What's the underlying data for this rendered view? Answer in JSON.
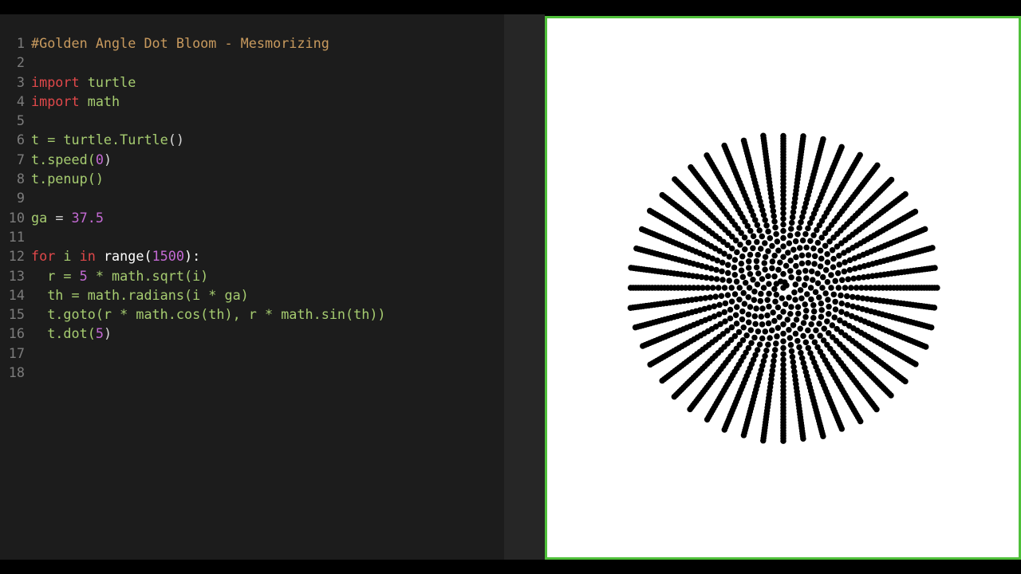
{
  "editor": {
    "lines": [
      {
        "num": "1",
        "tokens": [
          {
            "text": "#Golden Angle Dot Bloom - Mesmorizing",
            "kind": "comment"
          }
        ]
      },
      {
        "num": "2",
        "tokens": []
      },
      {
        "num": "3",
        "tokens": [
          {
            "text": "import",
            "kind": "keyword"
          },
          {
            "text": " turtle",
            "kind": "ident"
          }
        ]
      },
      {
        "num": "4",
        "tokens": [
          {
            "text": "import",
            "kind": "keyword"
          },
          {
            "text": " math",
            "kind": "ident"
          }
        ]
      },
      {
        "num": "5",
        "tokens": []
      },
      {
        "num": "6",
        "tokens": [
          {
            "text": "t = turtle.",
            "kind": "ident"
          },
          {
            "text": "Turtle",
            "kind": "ident"
          },
          {
            "text": "()",
            "kind": "default"
          }
        ]
      },
      {
        "num": "7",
        "tokens": [
          {
            "text": "t.speed(",
            "kind": "ident"
          },
          {
            "text": "0",
            "kind": "number"
          },
          {
            "text": ")",
            "kind": "default"
          }
        ]
      },
      {
        "num": "8",
        "tokens": [
          {
            "text": "t.penup()",
            "kind": "ident"
          }
        ]
      },
      {
        "num": "9",
        "tokens": []
      },
      {
        "num": "10",
        "tokens": [
          {
            "text": "ga",
            "kind": "ident"
          },
          {
            "text": " = ",
            "kind": "default"
          },
          {
            "text": "37.5",
            "kind": "number"
          }
        ]
      },
      {
        "num": "11",
        "tokens": []
      },
      {
        "num": "12",
        "tokens": [
          {
            "text": "for",
            "kind": "keyword"
          },
          {
            "text": " i ",
            "kind": "ident"
          },
          {
            "text": "in",
            "kind": "keyword"
          },
          {
            "text": " range(",
            "kind": "white"
          },
          {
            "text": "1500",
            "kind": "number"
          },
          {
            "text": "):",
            "kind": "white"
          }
        ]
      },
      {
        "num": "13",
        "tokens": [
          {
            "text": "  r = ",
            "kind": "ident"
          },
          {
            "text": "5",
            "kind": "number"
          },
          {
            "text": " * math.sqrt(i)",
            "kind": "ident"
          }
        ]
      },
      {
        "num": "14",
        "tokens": [
          {
            "text": "  th = math.radians(i * ga)",
            "kind": "ident"
          }
        ]
      },
      {
        "num": "15",
        "tokens": [
          {
            "text": "  t.goto(r * math.cos(th), r * math.sin(th))",
            "kind": "ident"
          }
        ]
      },
      {
        "num": "16",
        "tokens": [
          {
            "text": "  t.dot(",
            "kind": "ident"
          },
          {
            "text": "5",
            "kind": "number"
          },
          {
            "text": ")",
            "kind": "default"
          }
        ]
      },
      {
        "num": "17",
        "tokens": []
      },
      {
        "num": "18",
        "tokens": []
      }
    ]
  },
  "canvas": {
    "border_color": "#4fc03a",
    "drawing": {
      "count": 1500,
      "radius_scale": 5,
      "golden_angle_deg": 37.5,
      "dot_size": 5,
      "dot_color": "#000000"
    }
  }
}
